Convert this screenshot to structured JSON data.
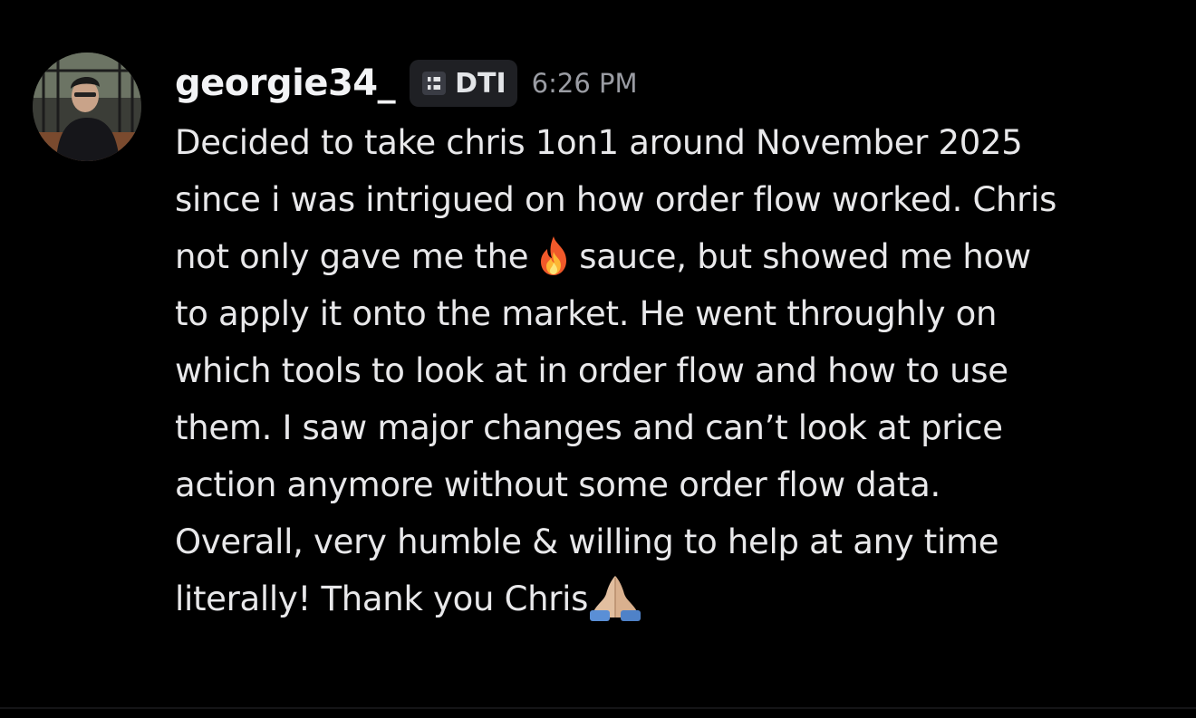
{
  "message": {
    "author": "georgie34_",
    "tag": {
      "icon": "dti-guild-icon",
      "label": "DTI"
    },
    "timestamp": "6:26 PM",
    "lines": [
      "Decided to take chris 1on1 around November 2025",
      "since i was intrigued on how order flow worked. Chris",
      "not only gave me the",
      "sauce, but showed me how",
      "to apply it onto the market. He went throughly on",
      "which tools to look at in order flow and how to use",
      "them. I saw major changes and can’t look at price",
      "action anymore without some order flow data.",
      "Overall, very humble & willing to help at any time",
      "literally! Thank you Chris"
    ],
    "emojis": [
      "fire-emoji",
      "folded-hands-emoji"
    ]
  },
  "colors": {
    "background": "#000000",
    "username": "#f2f3f5",
    "text": "#e8e8ea",
    "timestamp": "#9a9ca3",
    "tag_bg": "#1f2024"
  }
}
